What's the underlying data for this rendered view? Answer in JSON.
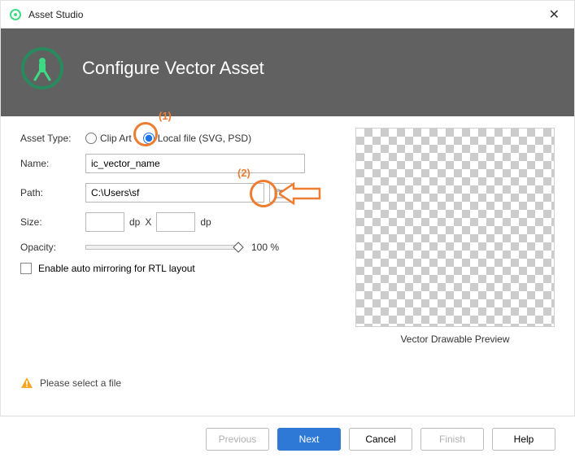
{
  "window": {
    "title": "Asset Studio"
  },
  "header": {
    "title": "Configure Vector Asset"
  },
  "form": {
    "asset_type_label": "Asset Type:",
    "radio_clip_art": "Clip Art",
    "radio_local_file": "Local file (SVG, PSD)",
    "name_label": "Name:",
    "name_value": "ic_vector_name",
    "path_label": "Path:",
    "path_value": "C:\\Users\\sf",
    "size_label": "Size:",
    "size_w": "",
    "size_h": "",
    "size_unit1": "dp",
    "size_sep": "X",
    "size_unit2": "dp",
    "opacity_label": "Opacity:",
    "opacity_value": "100 %",
    "rtl_label": "Enable auto mirroring for RTL layout"
  },
  "preview": {
    "label": "Vector Drawable Preview"
  },
  "warning": {
    "text": "Please select a file"
  },
  "buttons": {
    "previous": "Previous",
    "next": "Next",
    "cancel": "Cancel",
    "finish": "Finish",
    "help": "Help"
  },
  "annotations": {
    "one": "(1)",
    "two": "(2)"
  }
}
